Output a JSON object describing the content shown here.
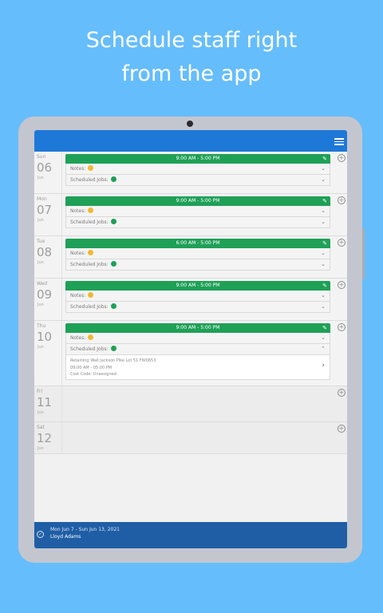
{
  "promo": {
    "line1": "Schedule staff right",
    "line2": "from the app"
  },
  "colors": {
    "background": "#66bdfb",
    "topbar": "#1e78d8",
    "shift_green": "#1fa057",
    "note_yellow": "#f2b833",
    "footer": "#1f5ea5"
  },
  "labels": {
    "notes": "Notes:",
    "scheduled_jobs": "Scheduled Jobs:",
    "add": "+",
    "edit": "✎",
    "chev_down": "⌄",
    "chev_up": "⌃"
  },
  "days": [
    {
      "dow": "Sun",
      "num": "06",
      "mon": "Jun",
      "shift": "9:00 AM - 5:00 PM"
    },
    {
      "dow": "Mon",
      "num": "07",
      "mon": "Jun",
      "shift": "9:00 AM - 5:00 PM"
    },
    {
      "dow": "Tue",
      "num": "08",
      "mon": "Jun",
      "shift": "6:00 AM - 5:00 PM"
    },
    {
      "dow": "Wed",
      "num": "09",
      "mon": "Jun",
      "shift": "9:00 AM - 5:00 PM"
    },
    {
      "dow": "Thu",
      "num": "10",
      "mon": "Jun",
      "shift": "9:00 AM - 5:00 PM",
      "job": {
        "title": "Retaining Wall Jackson Pike Lot 51 FW0653",
        "time": "09:00 AM - 05:00 PM",
        "cost": "Cost Code: Unassigned",
        "arrow": "›"
      }
    },
    {
      "dow": "Fri",
      "num": "11",
      "mon": "Jun"
    },
    {
      "dow": "Sat",
      "num": "12",
      "mon": "Jun"
    }
  ],
  "footer": {
    "range": "Mon Jun 7 - Sun Jun 13, 2021",
    "user": "Lloyd Adams",
    "check": "✓"
  }
}
